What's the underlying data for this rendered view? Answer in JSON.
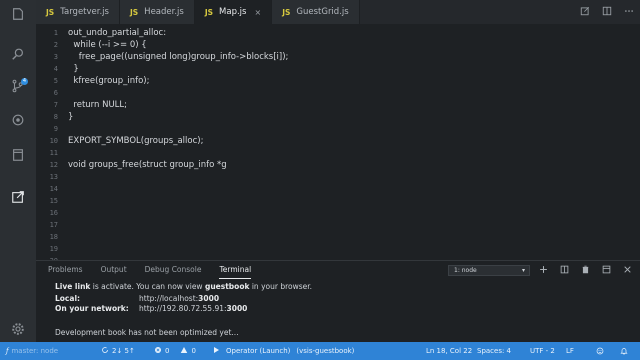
{
  "tabs": [
    {
      "icon": "JS",
      "label": "Targetver.js"
    },
    {
      "icon": "JS",
      "label": "Header.js"
    },
    {
      "icon": "JS",
      "label": "Map.js",
      "close": "×"
    },
    {
      "icon": "JS",
      "label": "GuestGrid.js"
    }
  ],
  "activity_icons": [
    "files-icon",
    "search-icon",
    "source-control-icon",
    "debug-icon",
    "extensions-icon",
    "remote-icon",
    "settings-icon"
  ],
  "activity_badge": "4",
  "line_numbers": [
    "1",
    "2",
    "3",
    "4",
    "5",
    "6",
    "7",
    "8",
    "9",
    "10",
    "11",
    "12",
    "13",
    "14",
    "15",
    "16",
    "17",
    "18",
    "19",
    "20"
  ],
  "code_lines": [
    "out_undo_partial_alloc:",
    "  while (--i >= 0) {",
    "    free_page((unsigned long)group_info->blocks[i]);",
    "  }",
    "  kfree(group_info);",
    "",
    "  return NULL;",
    "}",
    "",
    "EXPORT_SYMBOL(groups_alloc);",
    "",
    "void groups_free(struct group_info *g",
    "",
    "",
    "",
    "",
    "",
    "",
    "",
    ""
  ],
  "panel": {
    "tabs": [
      "Problems",
      "Output",
      "Debug Console",
      "Terminal"
    ],
    "active_tab": "Terminal",
    "terminal_select": "1: node",
    "terminal": {
      "live_prefix": "Live link",
      "live_middle": " is activate. You can now view ",
      "live_app": "guestbook",
      "live_suffix": " in your browser.",
      "local_label": "Local:",
      "local_url_prefix": "http://localhost:",
      "local_port": "3000",
      "network_label": "On your network:",
      "network_url_prefix": "http://192.80.72.55.91:",
      "network_port": "3000",
      "note": "Development book has not been optimized yet..."
    }
  },
  "status": {
    "branch": "master: node",
    "sync": "2↓ 5↑",
    "errors": "0",
    "warnings": "0",
    "launch": "Operator (Launch)",
    "workspace": "(vsis-guestbook)",
    "position": "Ln 18, Col 22",
    "spaces": "Spaces: 4",
    "encoding": "UTF - 2",
    "eol": "LF"
  },
  "colors": {
    "status_bar": "#2f83d6",
    "js_icon": "#d8ca3f",
    "editor_bg": "#1e2124"
  }
}
